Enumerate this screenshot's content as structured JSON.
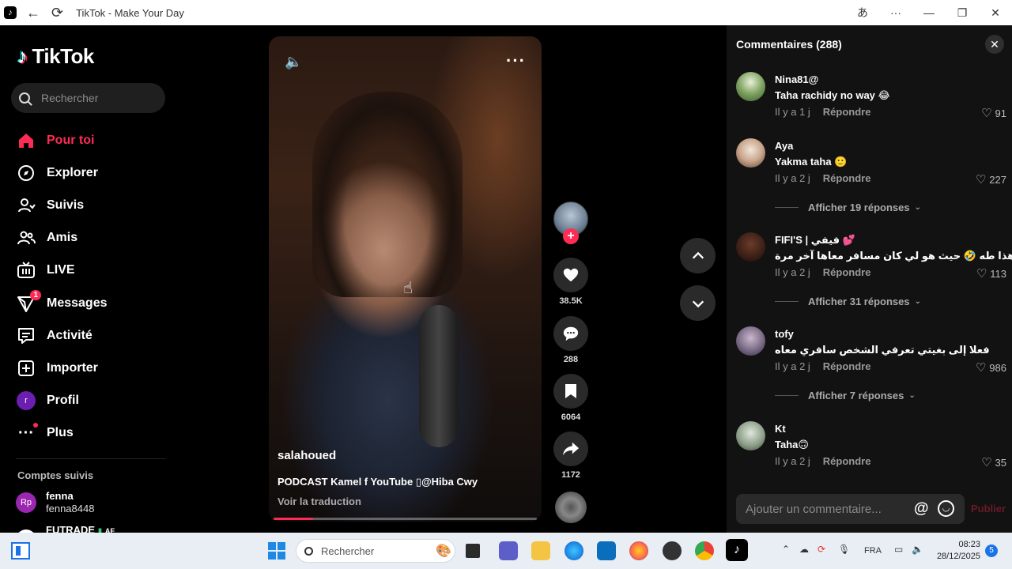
{
  "window": {
    "title": "TikTok - Make Your Day"
  },
  "sidebar": {
    "logo": "TikTok",
    "search_placeholder": "Rechercher",
    "items": [
      {
        "label": "Pour toi",
        "icon": "home-icon",
        "active": true
      },
      {
        "label": "Explorer",
        "icon": "compass-icon"
      },
      {
        "label": "Suivis",
        "icon": "following-icon"
      },
      {
        "label": "Amis",
        "icon": "friends-icon"
      },
      {
        "label": "LIVE",
        "icon": "live-icon"
      },
      {
        "label": "Messages",
        "icon": "messages-icon",
        "badge": "1"
      },
      {
        "label": "Activité",
        "icon": "activity-icon"
      },
      {
        "label": "Importer",
        "icon": "upload-icon"
      },
      {
        "label": "Profil",
        "icon": "profile-avatar",
        "avatar_letter": "r"
      },
      {
        "label": "Plus",
        "icon": "more-icon"
      }
    ],
    "followed_title": "Comptes suivis",
    "followed": [
      {
        "avatar": "Rp",
        "name": "fenna",
        "handle": "fenna8448"
      },
      {
        "name": "FUTRADE",
        "suffix": "AE"
      }
    ]
  },
  "video": {
    "author": "salahoued",
    "caption": "PODCAST Kamel f YouTube ▯@Hiba Cwy",
    "translate": "Voir la traduction",
    "progress": 0.15
  },
  "actions": {
    "likes": "38.5K",
    "comments": "288",
    "saves": "6064",
    "shares": "1172"
  },
  "comments": {
    "header": "Commentaires (288)",
    "input_placeholder": "Ajouter un commentaire...",
    "post_label": "Publier",
    "reply_label": "Répondre",
    "items": [
      {
        "user": "Nina81@",
        "text": "Taha rachidy no way 😂",
        "time": "Il y a 1 j",
        "likes": "91"
      },
      {
        "user": "Aya",
        "text": "Yakma taha 🙂",
        "time": "Il y a 2 j",
        "likes": "227",
        "more": "Afficher 19 réponses"
      },
      {
        "user": "FIFI'S | فيفي 💕",
        "text": "هذا طه 🤣 حيث هو لي كان مسافر معاها آخر مرة",
        "time": "Il y a 2 j",
        "likes": "113",
        "more": "Afficher 31 réponses"
      },
      {
        "user": "tofy",
        "text": "فعلا إلى بغيتي تعرفي الشخص سافري معاه",
        "time": "Il y a 2 j",
        "likes": "986",
        "more": "Afficher 7 réponses"
      },
      {
        "user": "Kt",
        "text": "Taha🙃",
        "time": "Il y a 2 j",
        "likes": "35"
      }
    ]
  },
  "taskbar": {
    "search_placeholder": "Rechercher",
    "language": "FRA",
    "time": "08:23",
    "date": "28/12/2025",
    "notifications": "5"
  }
}
